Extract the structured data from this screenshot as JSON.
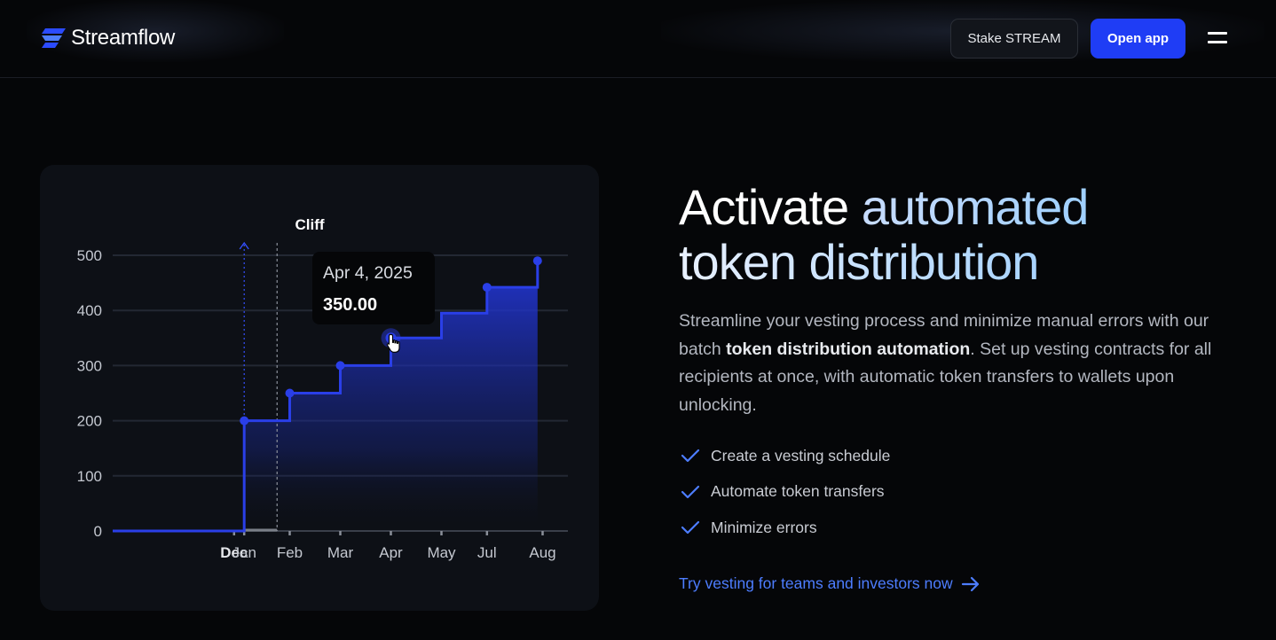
{
  "header": {
    "brand": "Streamflow",
    "stake_label": "Stake STREAM",
    "open_label": "Open app"
  },
  "hero": {
    "headline_plain": "Activate ",
    "headline_accent": "automated",
    "headline_line2": "token distribution",
    "desc_part1": "Streamline your vesting process and minimize manual errors with our batch ",
    "desc_bold": "token distribution automation",
    "desc_part2": ". Set up vesting contracts for all recipients at once, with automatic token transfers to wallets upon unlocking.",
    "features": [
      "Create a vesting schedule",
      "Automate token transfers",
      "Minimize errors"
    ],
    "cta_label": "Try vesting for teams and investors now"
  },
  "colors": {
    "accent_blue": "#1f3df5",
    "line_blue": "#2a3fe8",
    "link_blue": "#4d7dff",
    "background": "#050608"
  },
  "icons": {
    "brand": "streamflow-logo-icon",
    "menu": "hamburger-menu-icon",
    "check": "check-icon",
    "arrow": "arrow-right-icon",
    "cursor": "pointer-cursor-icon"
  },
  "chart_data": {
    "type": "area",
    "title": "",
    "cliff_label": "Cliff",
    "xlabel": "",
    "ylabel": "",
    "ylim": [
      0,
      500
    ],
    "yticks": [
      0,
      100,
      200,
      300,
      400,
      500
    ],
    "x_tick_labels": [
      "Dec",
      "Jan",
      "Feb",
      "Mar",
      "Apr",
      "May",
      "Jul",
      "Aug"
    ],
    "x_tick_positions": [
      0.8,
      1,
      1.9,
      2.9,
      3.9,
      4.9,
      5.8,
      6.9
    ],
    "bold_tick": "Dec",
    "xlim": [
      -1.6,
      7.4
    ],
    "cliff_x": 1.65,
    "series": [
      {
        "values_x": [
          -1.6,
          1,
          1,
          1.9,
          1.9,
          2.9,
          2.9,
          3.9,
          3.9,
          4.9,
          4.9,
          5.8,
          5.8,
          6.8,
          6.8
        ],
        "values_y": [
          0,
          0,
          200,
          200,
          250,
          250,
          300,
          300,
          350,
          350,
          395,
          395,
          442,
          442,
          490
        ]
      }
    ],
    "points": [
      {
        "x": 1,
        "y": 200
      },
      {
        "x": 1.9,
        "y": 250
      },
      {
        "x": 2.9,
        "y": 300
      },
      {
        "x": 3.9,
        "y": 350
      },
      {
        "x": 5.8,
        "y": 442
      },
      {
        "x": 6.8,
        "y": 490
      }
    ],
    "tooltip": {
      "date": "Apr 4, 2025",
      "value": "350.00",
      "x": 3.9,
      "y": 350
    },
    "grid": true
  }
}
